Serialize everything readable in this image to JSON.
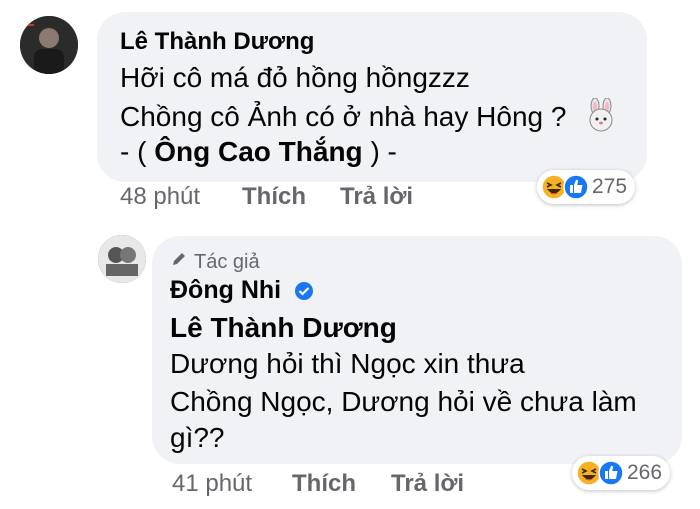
{
  "comment1": {
    "author": "Lê Thành Dương",
    "lines": [
      "Hỡi cô má đỏ hồng hồngzzz",
      "Chồng cô Ảnh có ở nhà hay Hông ?",
      "- (",
      "Ông Cao Thắng",
      ") -"
    ],
    "emoji": "rabbit-emoji",
    "time": "48 phút",
    "like": "Thích",
    "reply": "Trả lời",
    "reaction_count": "275"
  },
  "comment2": {
    "author_badge": "Tác giả",
    "author": "Đông Nhi",
    "tagged": "Lê Thành Dương",
    "lines": [
      "Dương hỏi thì Ngọc xin thưa",
      "Chồng Ngọc, Dương hỏi về chưa làm",
      "gì??"
    ],
    "time": "41 phút",
    "like": "Thích",
    "reply": "Trả lời",
    "reaction_count": "266"
  },
  "colors": {
    "bubble": "#f0f2f5",
    "meta_text": "#65676b",
    "like_blue": "#1877f2",
    "haha_yellow": "#f7b125"
  }
}
